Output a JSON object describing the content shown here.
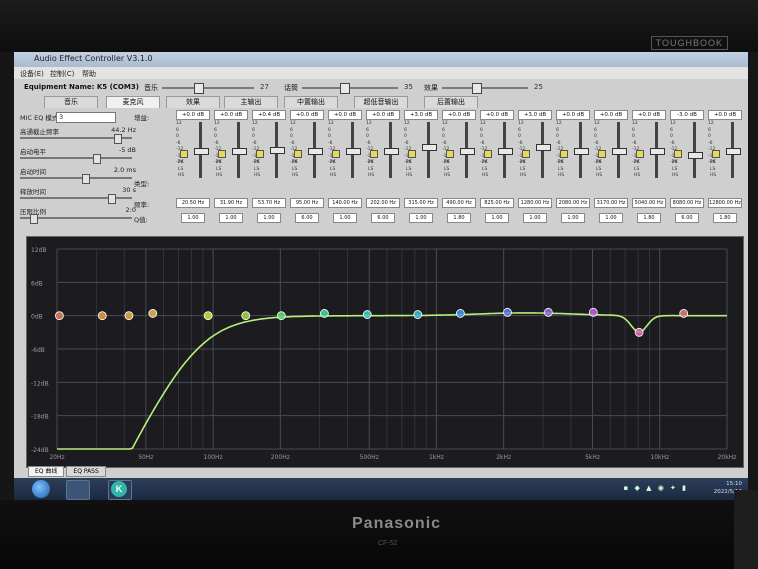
{
  "bezel": {
    "brand_top": "TOUGHBOOK",
    "brand_bottom": "Panasonic",
    "model": "CF-52"
  },
  "window": {
    "title": "Audio Effect Controller V3.1.0"
  },
  "menu": [
    "设备(E)",
    "控制(C)",
    "帮助"
  ],
  "device": {
    "label": "Equipment Name: K5 (COM3)",
    "music_label": "音乐",
    "music_value": "27",
    "mic_label": "话筒",
    "mic_value": "35",
    "effect_label": "效果",
    "effect_value": "25"
  },
  "tabs": [
    "音乐",
    "麦克风",
    "效果",
    "主输出",
    "中置输出",
    "超低音输出",
    "后置输出"
  ],
  "active_tab": 1,
  "left_panel": {
    "mic_eq_label": "MIC EQ 模式:",
    "mic_eq_value": "3",
    "rows": [
      {
        "label": "高通截止频率",
        "value": "44.2 Hz",
        "level": 0.9
      },
      {
        "label": "启动电平",
        "value": "-5 dB",
        "level": 0.7
      },
      {
        "label": "启动时间",
        "value": "2.0 ms",
        "level": 0.6
      },
      {
        "label": "释放时间",
        "value": "30 s",
        "level": 0.85
      },
      {
        "label": "压限比例",
        "value": "2:0",
        "level": 0.1
      }
    ]
  },
  "eq": {
    "gain_label": "增益:",
    "type_label": "类型:",
    "freq_label": "频率:",
    "q_label": "Q值:",
    "scale": [
      "12",
      "6",
      "0",
      "-6",
      "-12",
      "-18",
      "-24"
    ],
    "type_options": [
      "PK",
      "LS",
      "HS"
    ],
    "bands": [
      {
        "gain": "+0.0 dB",
        "freq": "20.50 Hz",
        "q": "1.00",
        "level": 0.5
      },
      {
        "gain": "+0.0 dB",
        "freq": "31.90 Hz",
        "q": "1.00",
        "level": 0.5
      },
      {
        "gain": "+0.4 dB",
        "freq": "53.70 Hz",
        "q": "1.00",
        "level": 0.51
      },
      {
        "gain": "+0.0 dB",
        "freq": "95.00 Hz",
        "q": "6.00",
        "level": 0.5
      },
      {
        "gain": "+0.0 dB",
        "freq": "140.00 Hz",
        "q": "1.00",
        "level": 0.5
      },
      {
        "gain": "+0.0 dB",
        "freq": "202.00 Hz",
        "q": "6.00",
        "level": 0.5
      },
      {
        "gain": "+3.0 dB",
        "freq": "315.00 Hz",
        "q": "1.00",
        "level": 0.58
      },
      {
        "gain": "+0.0 dB",
        "freq": "490.00 Hz",
        "q": "1.80",
        "level": 0.5
      },
      {
        "gain": "+0.0 dB",
        "freq": "825.00 Hz",
        "q": "1.00",
        "level": 0.5
      },
      {
        "gain": "+3.0 dB",
        "freq": "1280.00 Hz",
        "q": "1.00",
        "level": 0.58
      },
      {
        "gain": "+0.0 dB",
        "freq": "2080.00 Hz",
        "q": "1.00",
        "level": 0.5
      },
      {
        "gain": "+0.0 dB",
        "freq": "3170.00 Hz",
        "q": "1.00",
        "level": 0.5
      },
      {
        "gain": "+0.0 dB",
        "freq": "5040.00 Hz",
        "q": "1.80",
        "level": 0.5
      },
      {
        "gain": "-3.0 dB",
        "freq": "8080.00 Hz",
        "q": "6.00",
        "level": 0.42
      },
      {
        "gain": "+0.0 dB",
        "freq": "12800.00 Hz",
        "q": "1.80",
        "level": 0.5
      }
    ]
  },
  "graph": {
    "y_labels": [
      "12dB",
      "6dB",
      "0dB",
      "-6dB",
      "-12dB",
      "-18dB",
      "-24dB"
    ],
    "x_labels": [
      "20Hz",
      "50Hz",
      "100Hz",
      "200Hz",
      "500Hz",
      "1kHz",
      "2kHz",
      "5kHz",
      "10kHz",
      "20kHz"
    ],
    "x_ticks": [
      20,
      50,
      100,
      200,
      500,
      1000,
      2000,
      5000,
      10000,
      20000
    ],
    "grid": true,
    "curve_color": "#b6f07a",
    "points": [
      {
        "f": 20.5,
        "db": 0,
        "color": "#e0805a"
      },
      {
        "f": 31.9,
        "db": 0,
        "color": "#e8a040"
      },
      {
        "f": 42.0,
        "db": 0,
        "color": "#e8b048"
      },
      {
        "f": 53.7,
        "db": 0.4,
        "color": "#e8c050"
      },
      {
        "f": 95,
        "db": 0,
        "color": "#d8e040"
      },
      {
        "f": 140,
        "db": 0,
        "color": "#a0e040"
      },
      {
        "f": 202,
        "db": 0,
        "color": "#60e070"
      },
      {
        "f": 315,
        "db": 0.4,
        "color": "#40e0a0"
      },
      {
        "f": 490,
        "db": 0.2,
        "color": "#40d0d0"
      },
      {
        "f": 825,
        "db": 0.2,
        "color": "#40b8e0"
      },
      {
        "f": 1280,
        "db": 0.4,
        "color": "#4098e8"
      },
      {
        "f": 2080,
        "db": 0.6,
        "color": "#6080e8"
      },
      {
        "f": 3170,
        "db": 0.6,
        "color": "#9070e8"
      },
      {
        "f": 5040,
        "db": 0.6,
        "color": "#c060e0"
      },
      {
        "f": 8080,
        "db": -3,
        "color": "#e070b0"
      },
      {
        "f": 12800,
        "db": 0.4,
        "color": "#e08080"
      }
    ],
    "tabs": [
      "EQ 曲线",
      "EQ PASS"
    ]
  },
  "taskbar": {
    "clock_time": "15:10",
    "clock_date": "2022/5/12",
    "app_letter": "K"
  }
}
